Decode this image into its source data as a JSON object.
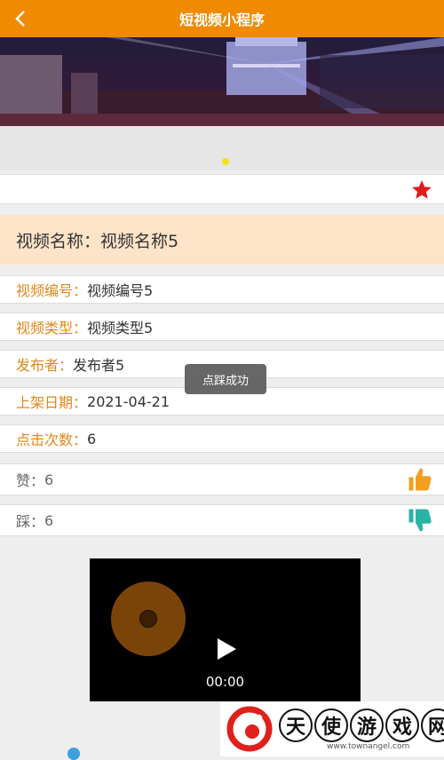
{
  "header": {
    "title": "短视频小程序",
    "back_icon": "chevron-left-icon"
  },
  "video": {
    "name_label": "视频名称：",
    "name_value": "视频名称5",
    "fields": [
      {
        "label": "视频编号：",
        "value": "视频编号5"
      },
      {
        "label": "视频类型：",
        "value": "视频类型5"
      },
      {
        "label": "发布者：",
        "value": "发布者5"
      },
      {
        "label": "上架日期：",
        "value": "2021-04-21"
      },
      {
        "label": "点击次数：",
        "value": "6"
      }
    ],
    "likes": {
      "label": "赞：",
      "value": "6",
      "icon": "thumbs-up-icon",
      "color": "#f0a020"
    },
    "dislikes": {
      "label": "踩：",
      "value": "6",
      "icon": "thumbs-down-icon",
      "color": "#2ab3a5"
    }
  },
  "favorite": {
    "icon": "star-icon",
    "color": "#e31b1b"
  },
  "toast": {
    "text": "点踩成功"
  },
  "player": {
    "time": "00:00"
  },
  "watermark": {
    "chars": [
      "天",
      "使",
      "游",
      "戏",
      "网"
    ],
    "url": "www.townangel.com"
  },
  "colors": {
    "accent": "#f08a00",
    "label": "#e0881a",
    "name_bg": "#fde3c8"
  }
}
